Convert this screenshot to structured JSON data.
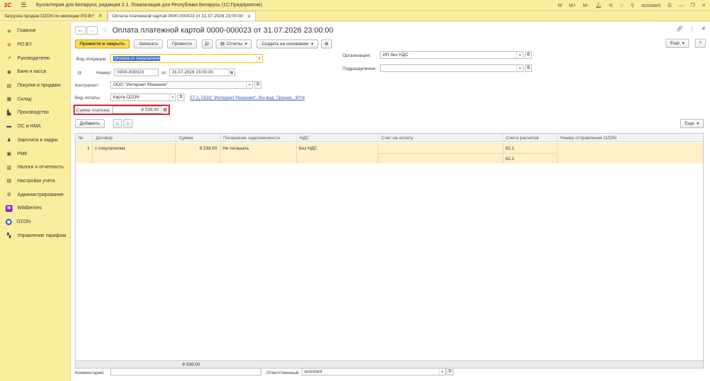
{
  "window": {
    "app_logo": "1С",
    "title": "Бухгалтерия для Беларуси, редакция 2.1. Локализация для Республики Беларусь  (1С:Предприятие)",
    "user": "assistant",
    "top_icons": [
      "M",
      "M+",
      "M-"
    ]
  },
  "tabs": [
    {
      "label": "Загрузка продаж OZON по месяцам РО.BY"
    },
    {
      "label": "Оплата платежной картой 0000-000023 от 31.07.2026 23:00:00"
    }
  ],
  "sidebar": {
    "items": [
      {
        "label": "Главное",
        "icon": "list-icon"
      },
      {
        "label": "РО.BY",
        "icon": "ro-icon"
      },
      {
        "label": "Руководителю",
        "icon": "chart-icon"
      },
      {
        "label": "Банк и касса",
        "icon": "bank-icon"
      },
      {
        "label": "Покупки и продажи",
        "icon": "cart-icon"
      },
      {
        "label": "Склад",
        "icon": "warehouse-icon"
      },
      {
        "label": "Производство",
        "icon": "factory-icon"
      },
      {
        "label": "ОС и НМА",
        "icon": "truck-icon"
      },
      {
        "label": "Зарплата и кадры",
        "icon": "people-icon"
      },
      {
        "label": "РМК",
        "icon": "register-icon"
      },
      {
        "label": "Налоги и отчетность",
        "icon": "tax-icon"
      },
      {
        "label": "Настройки учета",
        "icon": "settings-doc-icon"
      },
      {
        "label": "Администрирование",
        "icon": "gear-icon"
      },
      {
        "label": "Wildberries",
        "icon": "wildberries-icon"
      },
      {
        "label": "OZON",
        "icon": "ozon-icon"
      },
      {
        "label": "Управление тарифом",
        "icon": "tariff-icon"
      }
    ]
  },
  "doc": {
    "title": "Оплата платежной картой 0000-000023 от 31.07.2026 23:00:00"
  },
  "toolbar": {
    "post_close": "Провести и закрыть",
    "save": "Записать",
    "post": "Провести",
    "reports": "Отчеты",
    "create_based": "Создать на основании",
    "more": "Еще",
    "help": "?"
  },
  "form": {
    "op_type_label": "Вид операции:",
    "op_type_value": "Оплата от покупателя",
    "number_label": "Номер:",
    "number_value": "0000-000023",
    "date_label": "от:",
    "date_value": "31.07.2026 23:00:00",
    "org_label": "Организация:",
    "org_value": "ИП без НДС",
    "subdiv_label": "Подразделение:",
    "subdiv_value": "",
    "contractor_label": "Контрагент:",
    "contractor_value": "ООО \"Интернет Решения\"",
    "payment_type_label": "Вид оплаты:",
    "payment_type_value": "Карта OZON",
    "payment_link": "57.1, ООО \"Интернет Решения\", б/н вид: Прочее , BYN",
    "amount_label": "Сумма платежа:",
    "amount_value": "8 538,00"
  },
  "table_toolbar": {
    "add": "Добавить",
    "more": "Еще"
  },
  "table": {
    "columns": [
      "№",
      "Договор",
      "Сумма",
      "Погашение задолженности",
      "НДС",
      "Счет на оплату",
      "Счета расчетов",
      "Номер отправления OZON"
    ],
    "rows": [
      {
        "n": "1",
        "contract": "с покупателем",
        "sum": "8 538,00",
        "repay": "Не погашать",
        "vat": "Без НДС",
        "invoice": "",
        "accounts": [
          "62.1",
          "62.1"
        ],
        "ozon": ""
      }
    ],
    "total": "8 538,00"
  },
  "footer": {
    "comment_label": "Комментарий:",
    "comment_value": "",
    "responsible_label": "Ответственный:",
    "responsible_value": "assistant"
  }
}
